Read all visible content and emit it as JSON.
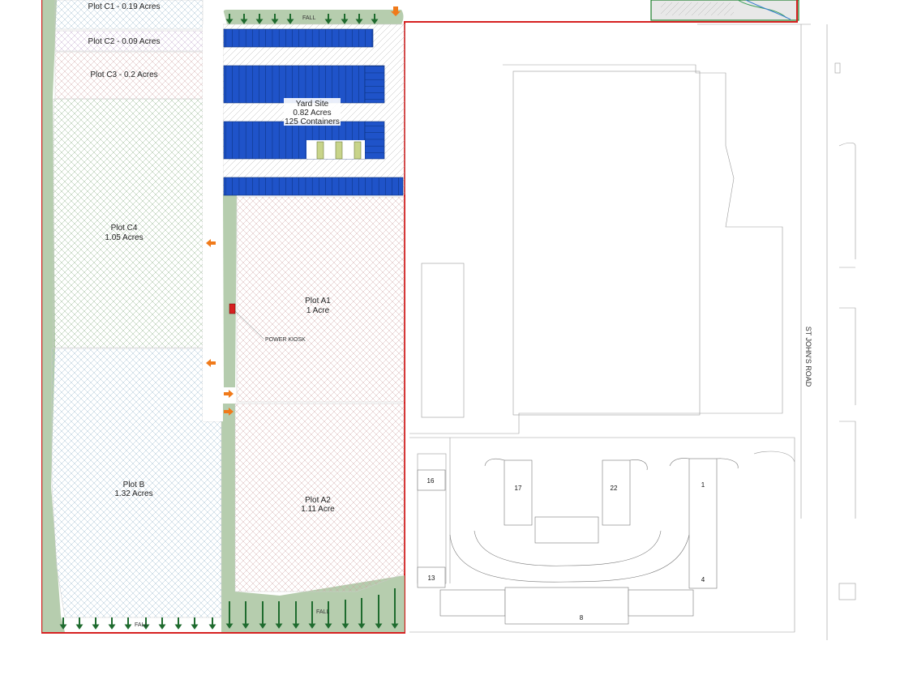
{
  "plots": {
    "c1": "Plot C1 - 0.19 Acres",
    "c2": "Plot C2 - 0.09 Acres",
    "c3": "Plot C3 - 0.2 Acres",
    "c4_name": "Plot C4",
    "c4_area": "1.05 Acres",
    "a1_name": "Plot A1",
    "a1_area": "1 Acre",
    "a2_name": "Plot A2",
    "a2_area": "1.11 Acre",
    "b_name": "Plot B",
    "b_area": "1.32 Acres"
  },
  "yard": {
    "name": "Yard Site",
    "area": "0.82 Acres",
    "containers": "125 Containers"
  },
  "power_kiosk": "POWER KIOSK",
  "road_name": "ST JOHN'S ROAD",
  "fall_label": "FALL",
  "unit_numbers": [
    "16",
    "17",
    "22",
    "1",
    "13",
    "4",
    "8"
  ],
  "colors": {
    "boundary": "#d62020",
    "container": "#1f53c9",
    "landscape": "#a9c4a0",
    "arrow_orange": "#f07a1a",
    "arrow_green": "#1e6b2e",
    "kiosk": "#d62020"
  }
}
